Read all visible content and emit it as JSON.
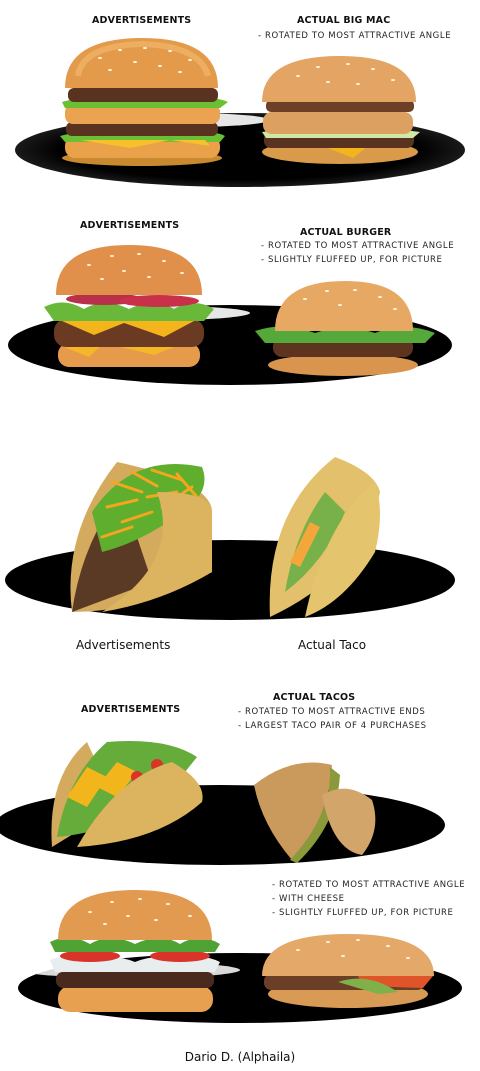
{
  "panel1": {
    "ad_label": "ADVERTISEMENTS",
    "actual_label": "ACTUAL BIG MAC",
    "notes": [
      "ROTATED TO MOST ATTRACTIVE ANGLE"
    ]
  },
  "panel2": {
    "ad_label": "ADVERTISEMENTS",
    "actual_label": "ACTUAL BURGER",
    "notes": [
      "ROTATED TO MOST ATTRACTIVE ANGLE",
      "SLIGHTLY FLUFFED UP, FOR PICTURE"
    ]
  },
  "panel3": {
    "ad_label": "Advertisements",
    "actual_label": "Actual Taco"
  },
  "panel4": {
    "ad_label": "ADVERTISEMENTS",
    "actual_label": "ACTUAL TACOS",
    "notes": [
      "ROTATED TO MOST ATTRACTIVE ENDS",
      "LARGEST TACO PAIR OF 4 PURCHASES"
    ]
  },
  "panel5": {
    "notes": [
      "ROTATED TO MOST ATTRACTIVE ANGLE",
      "WITH CHEESE",
      "SLIGHTLY FLUFFED UP, FOR PICTURE"
    ]
  },
  "credit": "Dario D. (Alphaila)",
  "colors": {
    "shadow": "#000000",
    "bun": "#d98a3a",
    "bun_light": "#f0b565",
    "patty": "#5a3320",
    "lettuce": "#5fae2e",
    "cheese": "#f4b51c",
    "tomato": "#d8342a",
    "taco_shell": "#dcb75a"
  }
}
